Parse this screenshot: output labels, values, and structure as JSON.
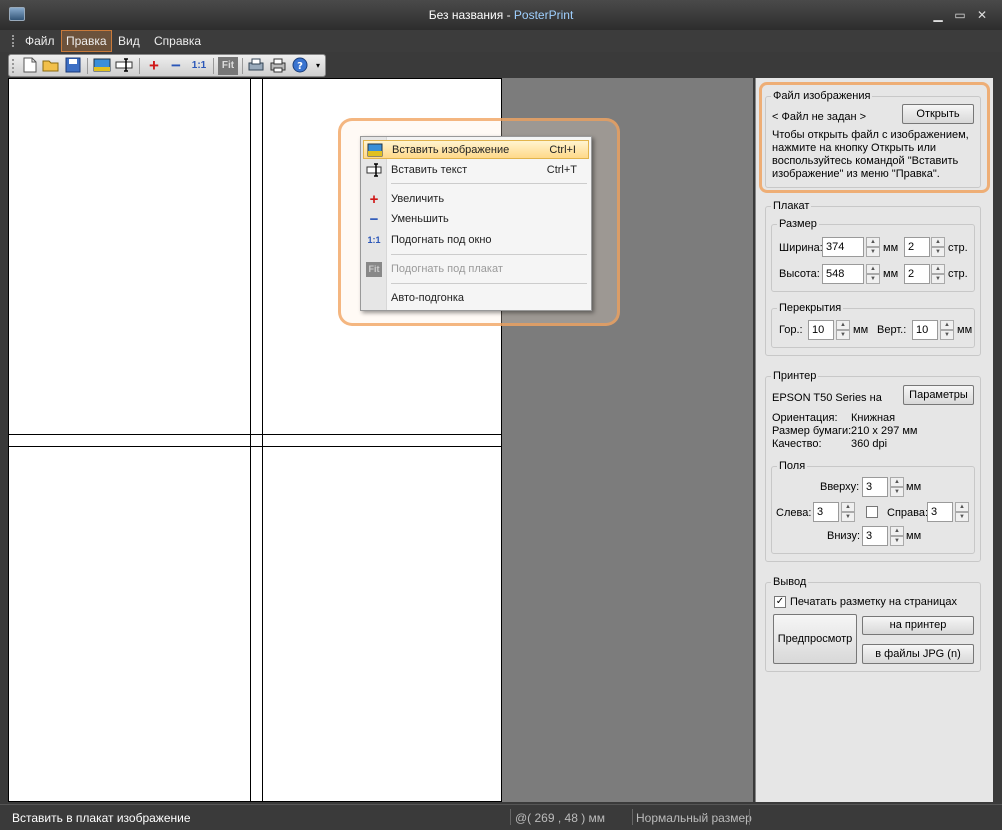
{
  "window": {
    "title_prefix": "Без названия - ",
    "title_app": "PosterPrint"
  },
  "menubar": {
    "items": [
      "Файл",
      "Правка",
      "Вид",
      "Справка"
    ],
    "active_index": 1
  },
  "toolbar": {
    "zoom_label": "1:1",
    "fit_label": "Fit"
  },
  "context_menu": {
    "items": [
      {
        "label": "Вставить изображение",
        "shortcut": "Ctrl+I",
        "icon": "insert-image-icon"
      },
      {
        "label": "Вставить текст",
        "shortcut": "Ctrl+T",
        "icon": "insert-text-icon"
      },
      {
        "label": "Увеличить",
        "icon": "zoom-in-icon"
      },
      {
        "label": "Уменьшить",
        "icon": "zoom-out-icon"
      },
      {
        "label": "Подогнать под окно",
        "icon": "fit-window-icon",
        "icon_text": "1:1"
      },
      {
        "label": "Подогнать под плакат",
        "icon": "fit-poster-icon",
        "icon_text": "Fit"
      },
      {
        "label": "Авто-подгонка"
      }
    ]
  },
  "image_file": {
    "title": "Файл изображения",
    "file_status": "< Файл не задан >",
    "open_button": "Открыть",
    "hint_lines": [
      "Чтобы открыть файл с изображением,",
      "нажмите на кнопку Открыть или",
      "воспользуйтесь командой \"Вставить",
      "изображение\" из меню \"Правка\"."
    ]
  },
  "poster": {
    "title": "Плакат",
    "size": {
      "title": "Размер",
      "width_label": "Ширина:",
      "width_value": "374",
      "width_pages": "2",
      "height_label": "Высота:",
      "height_value": "548",
      "height_pages": "2",
      "unit_mm": "мм",
      "unit_pages": "стр."
    },
    "overlap": {
      "title": "Перекрытия",
      "horizontal_label": "Гор.:",
      "horizontal_value": "10",
      "vertical_label": "Верт.:",
      "vertical_value": "10",
      "unit": "мм"
    }
  },
  "printer": {
    "title": "Принтер",
    "name": "EPSON T50 Series на",
    "params_button": "Параметры",
    "orientation_label": "Ориентация:",
    "orientation_value": "Книжная",
    "paper_label": "Размер бумаги:",
    "paper_value": "210 x 297 мм",
    "quality_label": "Качество:",
    "quality_value": "360 dpi",
    "margins": {
      "title": "Поля",
      "top_label": "Вверху:",
      "top_value": "3",
      "left_label": "Слева:",
      "left_value": "3",
      "right_label": "Справа:",
      "right_value": "3",
      "bottom_label": "Внизу:",
      "bottom_value": "3",
      "unit": "мм"
    }
  },
  "output": {
    "title": "Вывод",
    "print_marks_label": "Печатать разметку на страницах",
    "print_marks_checked": true,
    "preview_button": "Предпросмотр",
    "to_printer_button": "на принтер",
    "to_jpg_button": "в файлы JPG (n)"
  },
  "statusbar": {
    "message": "Вставить в плакат изображение",
    "coords": "@( 269 , 48 ) мм",
    "zoom": "Нормальный размер"
  },
  "colors": {
    "title_accent": "#9fd0ff",
    "highlight_orange": "#f0a05a",
    "canvas_gray": "#7c7c7c"
  }
}
